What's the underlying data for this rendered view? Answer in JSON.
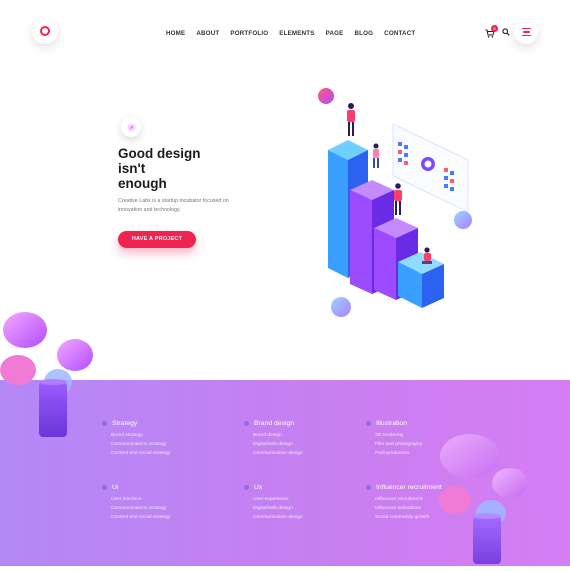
{
  "header": {
    "logo_icon": "logo-ring-icon",
    "nav": [
      "HOME",
      "ABOUT",
      "PORTFOLIO",
      "ELEMENTS",
      "PAGE",
      "BLOG",
      "CONTACT"
    ],
    "cart_count": "0",
    "cart_icon": "cart-icon",
    "search_icon": "search-icon",
    "menu_icon": "hamburger-menu-icon"
  },
  "hero": {
    "badge_icon": "compass-icon",
    "title_lines": [
      "Good design",
      "isn't",
      "enough"
    ],
    "subtitle": "Creative Labs is a startup incubator focused on innovation and technology.",
    "cta_label": "HAVE A PROJECT"
  },
  "services": [
    {
      "title": "Strategy",
      "items": [
        "Brand strategy",
        "Communications strategy",
        "Content and social strategy"
      ]
    },
    {
      "title": "Brand design",
      "items": [
        "Brand design",
        "Digital/web design",
        "Communication design"
      ]
    },
    {
      "title": "Illustration",
      "items": [
        "3D rendering",
        "Film and photography",
        "Post-production"
      ]
    },
    {
      "title": "Ui",
      "items": [
        "User interface",
        "Communications strategy",
        "Content and social strategy"
      ]
    },
    {
      "title": "Ux",
      "items": [
        "User experience",
        "Digital/web design",
        "Communication design"
      ]
    },
    {
      "title": "Influencer recruitment",
      "items": [
        "Influencer recruitment",
        "Influencer activations",
        "Social community growth"
      ]
    }
  ],
  "colors": {
    "accent": "#f0254f",
    "band_start": "#b388f7",
    "band_end": "#d67df4"
  }
}
